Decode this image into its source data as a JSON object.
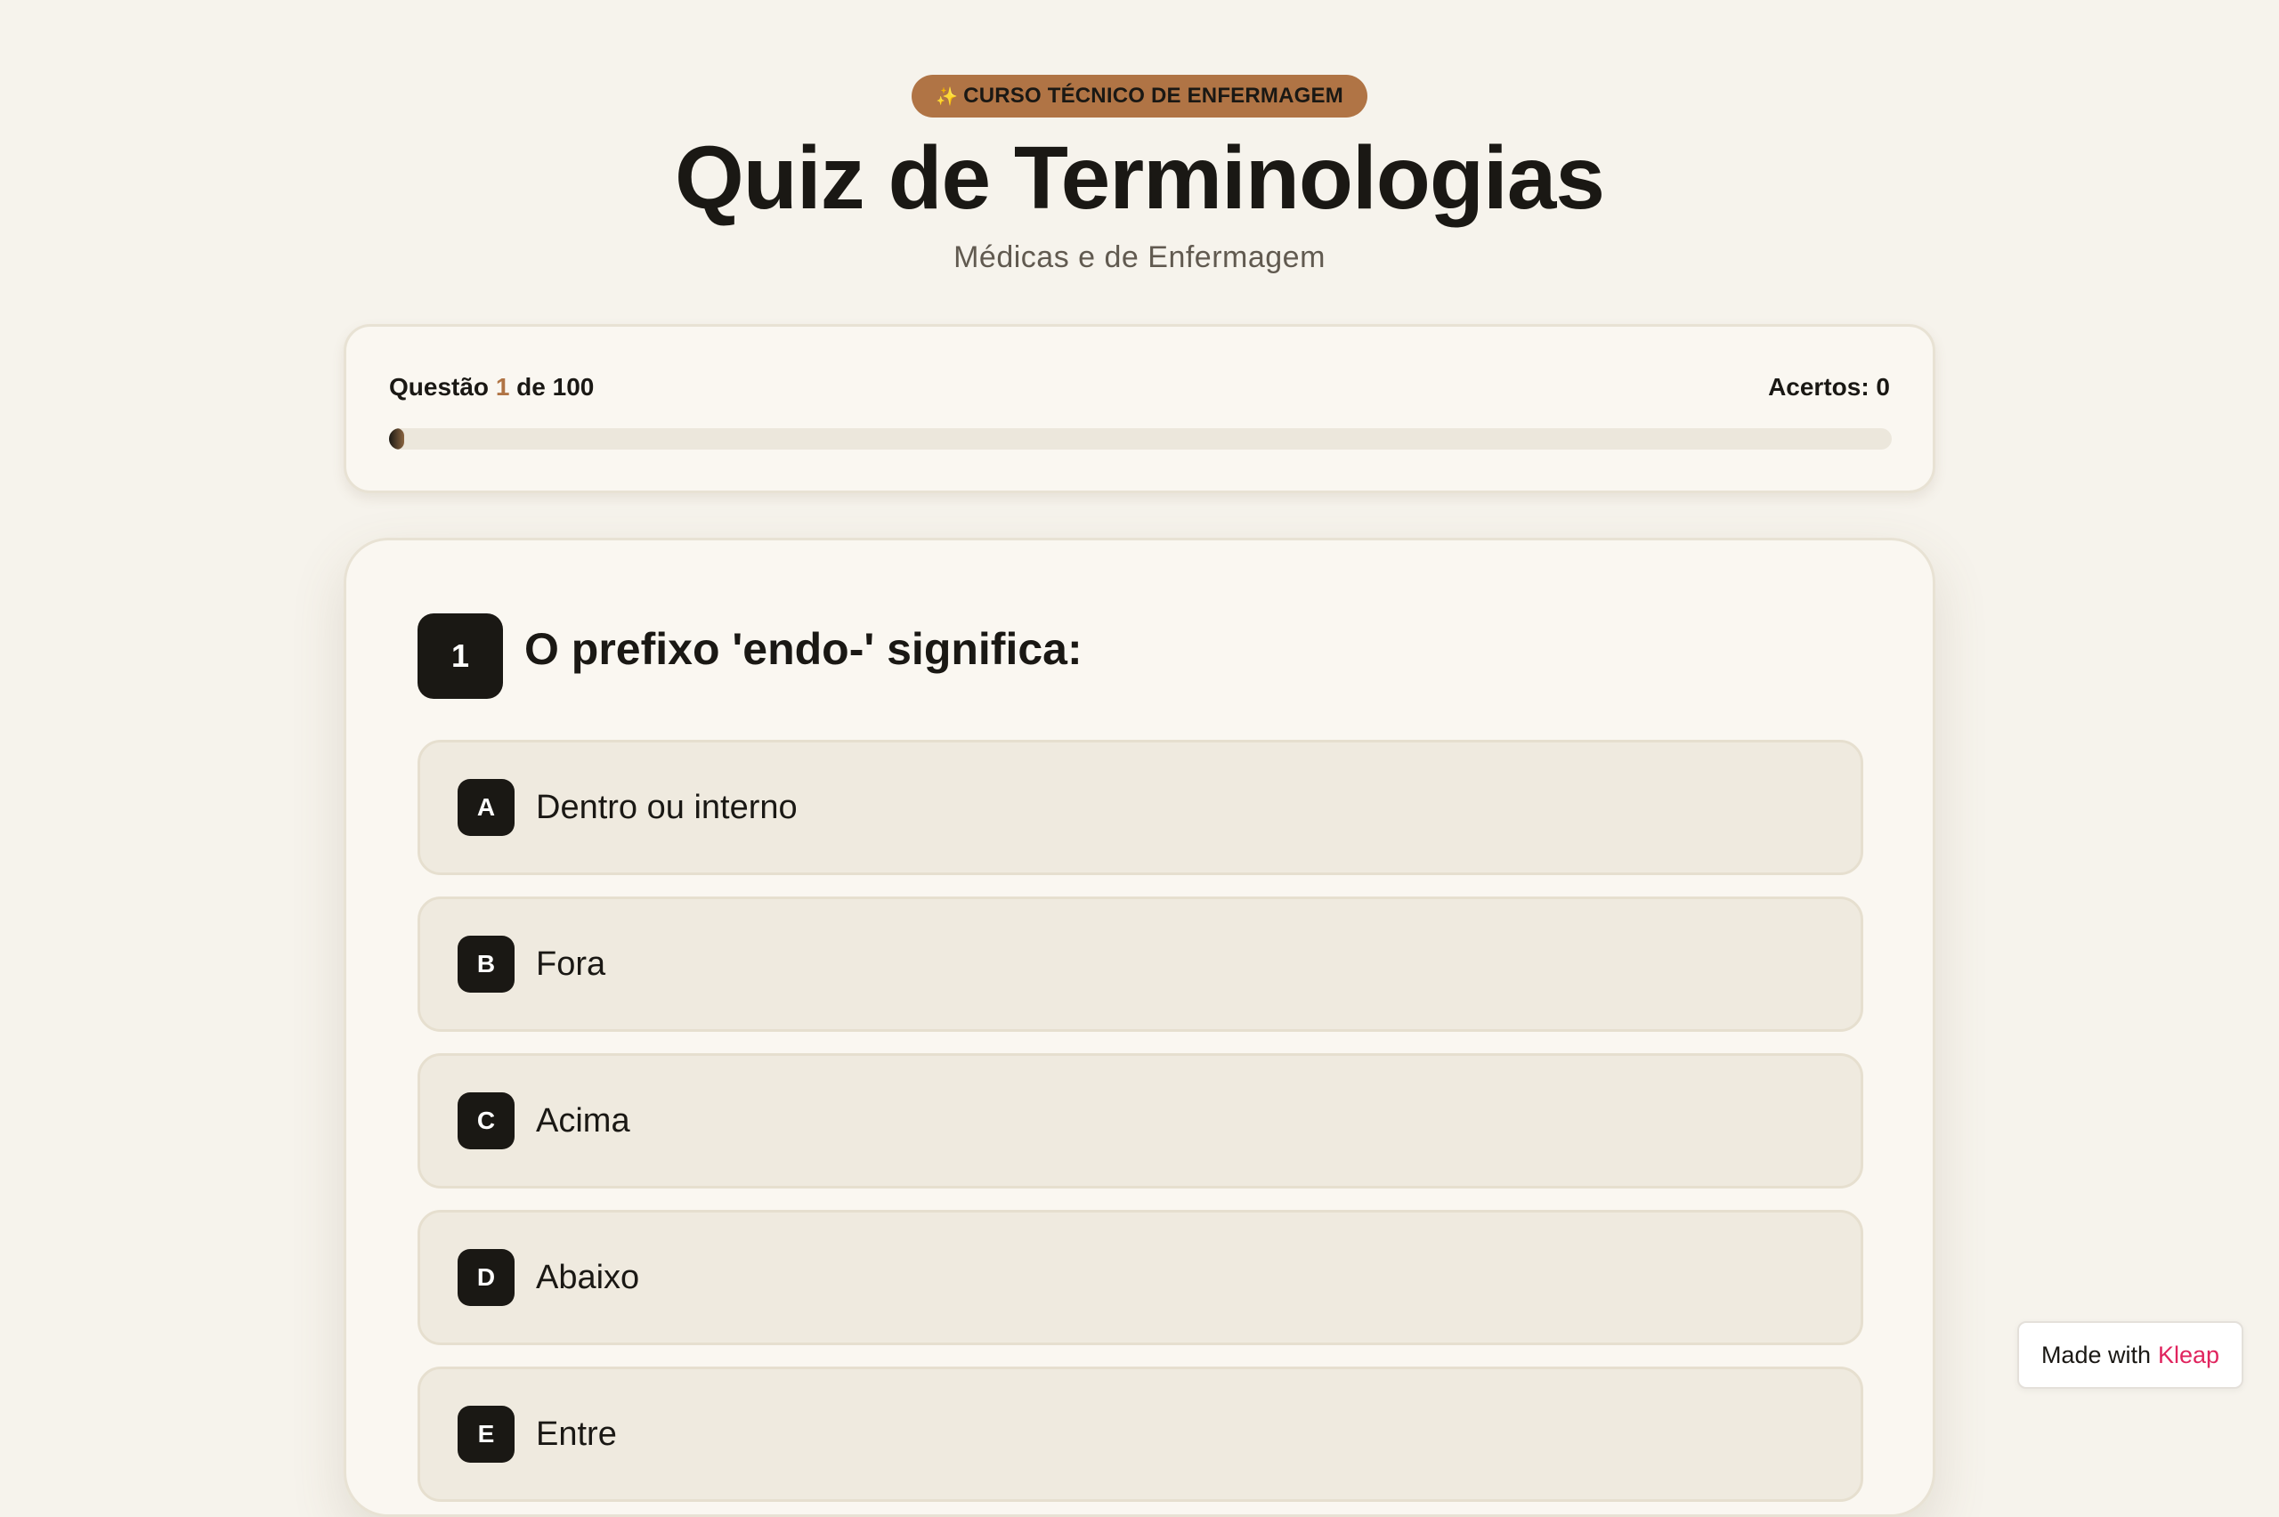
{
  "header": {
    "badge_icon": "sparkle-icon",
    "badge_text": "CURSO TÉCNICO DE ENFERMAGEM",
    "title": "Quiz de Terminologias",
    "subtitle": "Médicas e de Enfermagem"
  },
  "progress": {
    "label_prefix": "Questão",
    "current": "1",
    "label_middle": "de",
    "total": "100",
    "score_label": "Acertos: 0",
    "fraction": 0.01
  },
  "question": {
    "number": "1",
    "text": "O prefixo 'endo-' significa:",
    "options": [
      {
        "letter": "A",
        "text": "Dentro ou interno"
      },
      {
        "letter": "B",
        "text": "Fora"
      },
      {
        "letter": "C",
        "text": "Acima"
      },
      {
        "letter": "D",
        "text": "Abaixo"
      },
      {
        "letter": "E",
        "text": "Entre"
      }
    ]
  },
  "footer": {
    "made_with": "Made with",
    "brand": "Kleap"
  },
  "colors": {
    "background": "#f6f3ec",
    "accent": "#b07445",
    "dark": "#1a1814",
    "brand": "#e0245e"
  }
}
